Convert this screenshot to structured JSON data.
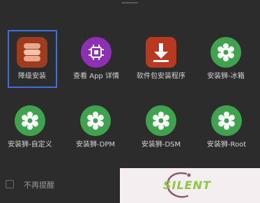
{
  "apps": [
    {
      "label": "降级安装",
      "icon": "stacked-layers-icon",
      "color": "#a13b1e",
      "selected": true
    },
    {
      "label": "查看 App 详情",
      "icon": "chip-icon",
      "color": "#8e2fb5"
    },
    {
      "label": "软件包安装程序",
      "icon": "download-arrow-icon",
      "color": "#b8391f"
    },
    {
      "label": "安装狮-冰箱",
      "icon": "gear-flower-icon",
      "color": "#3fa34d"
    },
    {
      "label": "安装狮-自定义",
      "icon": "gear-flower-icon",
      "color": "#3fa34d"
    },
    {
      "label": "安装狮-DPM",
      "icon": "gear-flower-icon",
      "color": "#3fa34d"
    },
    {
      "label": "安装狮-DSM",
      "icon": "gear-flower-icon",
      "color": "#3fa34d"
    },
    {
      "label": "安装狮-Root",
      "icon": "gear-flower-icon",
      "color": "#3fa34d"
    }
  ],
  "no_remind": {
    "label": "不再提醒",
    "checked": false
  },
  "watermark": {
    "text": "SILENT"
  },
  "colors": {
    "background": "#2c2c2c",
    "selection": "#3d6fe0",
    "watermark_bg": "#f4eef0",
    "watermark_text": "#8dc63f"
  }
}
